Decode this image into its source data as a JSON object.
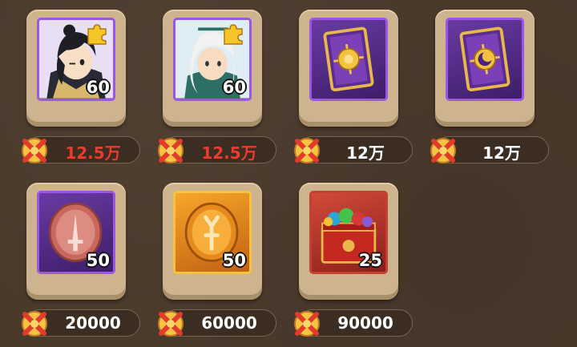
{
  "items": [
    {
      "name": "hero-shard-1",
      "quantity": "60",
      "price": "12.5万",
      "price_color": "red",
      "frame": "purple",
      "icon": "hero-dark-hair-portrait",
      "has_puzzle": true
    },
    {
      "name": "hero-shard-2",
      "quantity": "60",
      "price": "12.5万",
      "price_color": "red",
      "frame": "purple",
      "icon": "hero-white-hair-portrait",
      "has_puzzle": true
    },
    {
      "name": "sun-card",
      "quantity": "",
      "price": "12万",
      "price_color": "white",
      "frame": "purple",
      "icon": "sun-card-icon",
      "has_puzzle": false
    },
    {
      "name": "moon-card",
      "quantity": "",
      "price": "12万",
      "price_color": "white",
      "frame": "purple",
      "icon": "moon-card-icon",
      "has_puzzle": false
    },
    {
      "name": "sword-coin",
      "quantity": "50",
      "price": "20000",
      "price_color": "white",
      "frame": "purple",
      "icon": "sword-coin-icon",
      "has_puzzle": false
    },
    {
      "name": "gold-coin",
      "quantity": "50",
      "price": "60000",
      "price_color": "white",
      "frame": "orange",
      "icon": "gold-coin-icon",
      "has_puzzle": false
    },
    {
      "name": "gem-chest",
      "quantity": "25",
      "price": "90000",
      "price_color": "white",
      "frame": "red",
      "icon": "gem-chest-icon",
      "has_puzzle": false
    }
  ],
  "currency_icon": "crossed-coin-icon"
}
